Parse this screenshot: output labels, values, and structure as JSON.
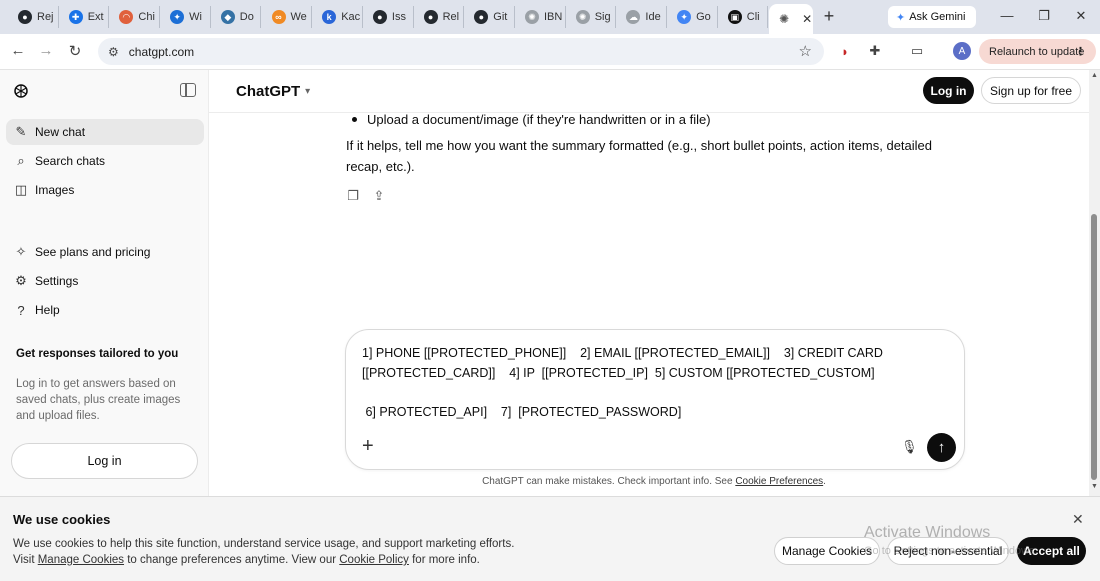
{
  "browser": {
    "tabs": [
      {
        "label": "Rej",
        "icon": "github-icon",
        "color": "#24292f",
        "glyph": "●"
      },
      {
        "label": "Ext",
        "icon": "puzzle-icon",
        "color": "#1a73e8",
        "glyph": "✚"
      },
      {
        "label": "Chi",
        "icon": "rainbow-icon",
        "color": "#e0603c",
        "glyph": "◠"
      },
      {
        "label": "Wi",
        "icon": "bird-icon",
        "color": "#1d6fd6",
        "glyph": "✦"
      },
      {
        "label": "Do",
        "icon": "python-icon",
        "color": "#3572a5",
        "glyph": "◆"
      },
      {
        "label": "We",
        "icon": "link-icon",
        "color": "#f08a24",
        "glyph": "∞"
      },
      {
        "label": "Kac",
        "icon": "k-icon",
        "color": "#2a66d8",
        "glyph": "k"
      },
      {
        "label": "Iss",
        "icon": "github-icon",
        "color": "#24292f",
        "glyph": "●"
      },
      {
        "label": "Rel",
        "icon": "github-icon",
        "color": "#24292f",
        "glyph": "●"
      },
      {
        "label": "Git",
        "icon": "github-icon",
        "color": "#24292f",
        "glyph": "●"
      },
      {
        "label": "IBN",
        "icon": "openai-icon",
        "color": "#9aa0a6",
        "glyph": "✺"
      },
      {
        "label": "Sig",
        "icon": "openai-icon",
        "color": "#9aa0a6",
        "glyph": "✺"
      },
      {
        "label": "Ide",
        "icon": "cloud-icon",
        "color": "#9aa0a6",
        "glyph": "☁"
      },
      {
        "label": "Go",
        "icon": "gemini-icon",
        "color": "#4285f4",
        "glyph": "✦"
      },
      {
        "label": "Cli",
        "icon": "terminal-icon",
        "color": "#111111",
        "glyph": "▣"
      }
    ],
    "active_tab": {
      "icon": "openai-icon"
    },
    "gemini_label": "Ask Gemini",
    "url": "chatgpt.com",
    "relaunch_label": "Relaunch to update",
    "profile_initial": "A"
  },
  "sidebar": {
    "items": [
      {
        "label": "New chat",
        "icon": "edit-icon",
        "glyph": "✎"
      },
      {
        "label": "Search chats",
        "icon": "search-icon",
        "glyph": "⌕"
      },
      {
        "label": "Images",
        "icon": "images-icon",
        "glyph": "◫"
      }
    ],
    "secondary_items": [
      {
        "label": "See plans and pricing",
        "icon": "sparkle-icon",
        "glyph": "✧"
      },
      {
        "label": "Settings",
        "icon": "gear-icon",
        "glyph": "⚙"
      },
      {
        "label": "Help",
        "icon": "help-icon",
        "glyph": "?"
      }
    ],
    "promo_title": "Get responses tailored to you",
    "promo_text": "Log in to get answers based on saved chats, plus create images and upload files.",
    "login_label": "Log in"
  },
  "header": {
    "model_label": "ChatGPT",
    "login_label": "Log in",
    "signup_label": "Sign up for free"
  },
  "conversation": {
    "bullet_text": "Upload a document/image (if they're handwritten or in a file)",
    "paragraph": "If it helps, tell me how you want the summary formatted (e.g., short bullet points, action items, detailed recap, etc.)."
  },
  "composer": {
    "text": "1] PHONE [[PROTECTED_PHONE]]    2] EMAIL [[PROTECTED_EMAIL]]    3] CREDIT CARD\n[[PROTECTED_CARD]]    4] IP  [[PROTECTED_IP]  5] CUSTOM [[PROTECTED_CUSTOM]\n\n 6] PROTECTED_API]    7]  [PROTECTED_PASSWORD]"
  },
  "disclaimer": {
    "text": "ChatGPT can make mistakes. Check important info. See ",
    "link": "Cookie Preferences",
    "end": "."
  },
  "cookie": {
    "title": "We use cookies",
    "line1": "We use cookies to help this site function, understand service usage, and support marketing efforts.",
    "line2_start": "Visit ",
    "line2_link1": "Manage Cookies",
    "line2_mid": " to change preferences anytime. View our ",
    "line2_link2": "Cookie Policy",
    "line2_end": " for more info.",
    "manage_label": "Manage Cookies",
    "reject_label": "Reject non-essential",
    "accept_label": "Accept all"
  },
  "watermark": {
    "line1": "Activate Windows",
    "line2": "Go to Settings to activate Windows."
  }
}
